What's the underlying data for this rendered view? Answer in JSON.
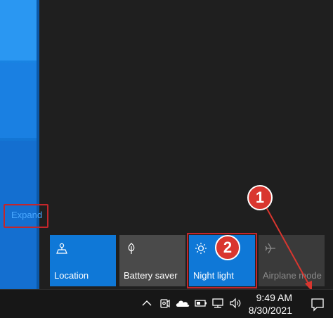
{
  "action_center": {
    "expand_label": "Expand",
    "tiles": [
      {
        "label": "Location",
        "icon": "location-icon",
        "state": "on"
      },
      {
        "label": "Battery saver",
        "icon": "battery-saver-icon",
        "state": "off"
      },
      {
        "label": "Night light",
        "icon": "night-light-icon",
        "state": "on"
      },
      {
        "label": "Airplane mode",
        "icon": "airplane-icon",
        "state": "disabled"
      }
    ]
  },
  "callouts": {
    "first": "1",
    "second": "2"
  },
  "taskbar": {
    "time": "9:49 AM",
    "date": "8/30/2021",
    "tray_icons": [
      "chevron-up-icon",
      "meet-now-icon",
      "onedrive-cloud-icon",
      "battery-icon",
      "network-icon",
      "volume-icon"
    ],
    "notification_icon": "notification-icon"
  },
  "colors": {
    "accent": "#0f78d7",
    "tile_off": "#4a4a4a",
    "highlight": "#c4262b",
    "panel_bg": "#1f1f1f",
    "taskbar_bg": "#171717"
  }
}
